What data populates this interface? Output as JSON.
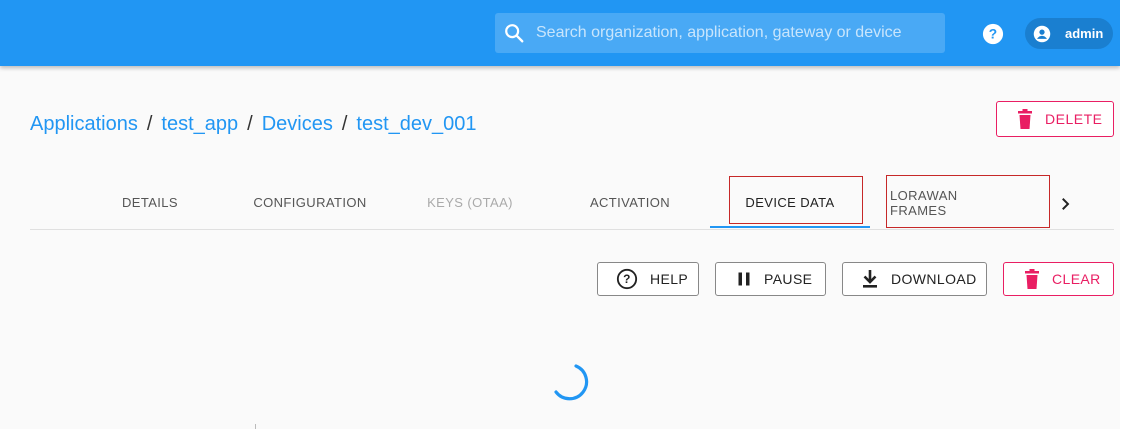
{
  "header": {
    "search": {
      "placeholder": "Search organization, application, gateway or device",
      "icon": "search-icon"
    },
    "help_icon": "help-circle-icon",
    "user": {
      "name": "admin",
      "icon": "account-circle-icon"
    },
    "color": "#2196f3"
  },
  "breadcrumb": {
    "items": [
      "Applications",
      "test_app",
      "Devices",
      "test_dev_001"
    ],
    "separator": "/"
  },
  "delete_button": {
    "label": "DELETE",
    "icon": "trash-icon",
    "color": "#e91e63"
  },
  "tabs": {
    "items": [
      {
        "label": "DETAILS",
        "state": "normal"
      },
      {
        "label": "CONFIGURATION",
        "state": "normal"
      },
      {
        "label": "KEYS (OTAA)",
        "state": "disabled"
      },
      {
        "label": "ACTIVATION",
        "state": "normal"
      },
      {
        "label": "DEVICE DATA",
        "state": "active"
      },
      {
        "label": "LORAWAN FRAMES",
        "state": "normal"
      }
    ],
    "scroll_icon": "chevron-right-icon",
    "indicator_color": "#2196f3"
  },
  "actions": {
    "help": {
      "label": "HELP",
      "icon": "help-circle-outline-icon"
    },
    "pause": {
      "label": "PAUSE",
      "icon": "pause-icon"
    },
    "download": {
      "label": "DOWNLOAD",
      "icon": "download-icon"
    },
    "clear": {
      "label": "CLEAR",
      "icon": "trash-icon",
      "color": "#e91e63"
    }
  },
  "loading": {
    "icon": "spinner-icon"
  }
}
